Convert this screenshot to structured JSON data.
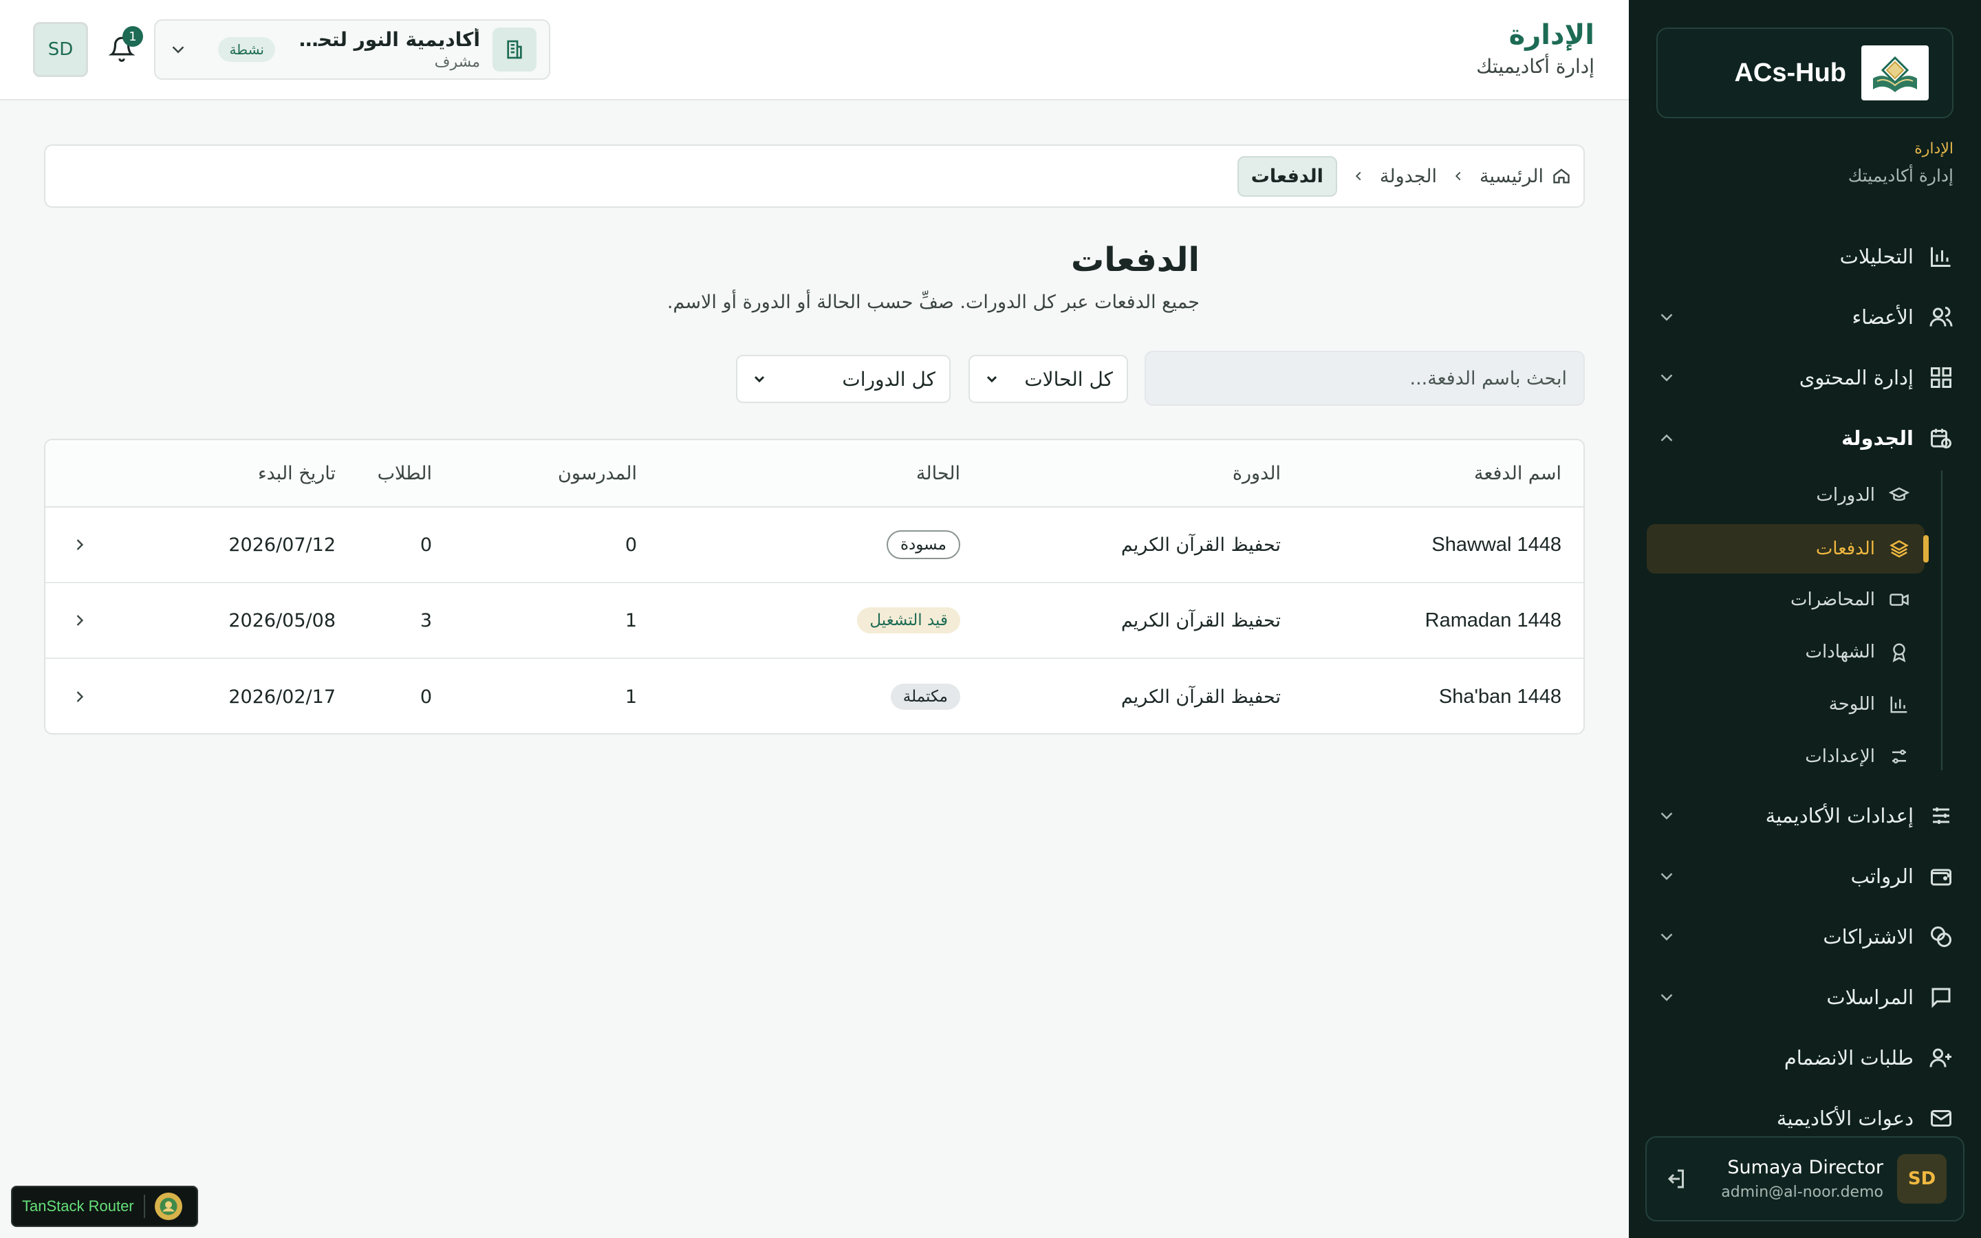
{
  "sidebar": {
    "brand": "ACs-Hub",
    "section_title": "الإدارة",
    "section_subtitle": "إدارة أكاديميتك",
    "items": [
      {
        "label": "التحليلات",
        "icon": "chart-icon"
      },
      {
        "label": "الأعضاء",
        "icon": "users-icon"
      },
      {
        "label": "إدارة المحتوى",
        "icon": "grid-icon"
      },
      {
        "label": "الجدولة",
        "icon": "calendar-clock-icon"
      },
      {
        "label": "إعدادات الأكاديمية",
        "icon": "sliders-icon"
      },
      {
        "label": "الرواتب",
        "icon": "wallet-icon"
      },
      {
        "label": "الاشتراكات",
        "icon": "coins-icon"
      },
      {
        "label": "المراسلات",
        "icon": "message-icon"
      },
      {
        "label": "طلبات الانضمام",
        "icon": "user-plus-icon"
      },
      {
        "label": "دعوات الأكاديمية",
        "icon": "mail-icon"
      }
    ],
    "schedule_sub": [
      {
        "label": "الدورات",
        "icon": "graduation-cap-icon"
      },
      {
        "label": "الدفعات",
        "icon": "layers-icon"
      },
      {
        "label": "المحاضرات",
        "icon": "video-icon"
      },
      {
        "label": "الشهادات",
        "icon": "award-icon"
      },
      {
        "label": "اللوحة",
        "icon": "chart-icon"
      },
      {
        "label": "الإعدادات",
        "icon": "settings-sliders-icon"
      }
    ],
    "user": {
      "name": "Sumaya Director",
      "email": "admin@al-noor.demo",
      "initials": "SD"
    }
  },
  "header": {
    "title": "الإدارة",
    "subtitle": "إدارة أكاديميتك",
    "academy": {
      "name": "أكاديمية النور لتحفيظ ا...",
      "role": "مشرف",
      "status": "نشطة"
    },
    "notifications": "1",
    "avatar": "SD"
  },
  "breadcrumb": {
    "home": "الرئيسية",
    "schedule": "الجدولة",
    "current": "الدفعات"
  },
  "page": {
    "title": "الدفعات",
    "description": "جميع الدفعات عبر كل الدورات. صفِّ حسب الحالة أو الدورة أو الاسم.",
    "search_placeholder": "ابحث باسم الدفعة...",
    "status_filter": "كل الحالات",
    "course_filter": "كل الدورات"
  },
  "table": {
    "headers": {
      "name": "اسم الدفعة",
      "course": "الدورة",
      "status": "الحالة",
      "teachers": "المدرسون",
      "students": "الطلاب",
      "start": "تاريخ البدء"
    },
    "rows": [
      {
        "name": "Shawwal 1448",
        "course": "تحفيظ القرآن الكريم",
        "status": "مسودة",
        "teachers": "0",
        "students": "0",
        "start": "2026/07/12"
      },
      {
        "name": "Ramadan 1448",
        "course": "تحفيظ القرآن الكريم",
        "status": "قيد التشغيل",
        "teachers": "1",
        "students": "3",
        "start": "2026/05/08"
      },
      {
        "name": "Sha'ban 1448",
        "course": "تحفيظ القرآن الكريم",
        "status": "مكتملة",
        "teachers": "1",
        "students": "0",
        "start": "2026/02/17"
      }
    ]
  },
  "devtools": {
    "label": "TanStack Router"
  },
  "colors": {
    "sidebar_bg": "#0e1f1c",
    "accent_green": "#1d6b54",
    "accent_gold": "#f0b840"
  }
}
